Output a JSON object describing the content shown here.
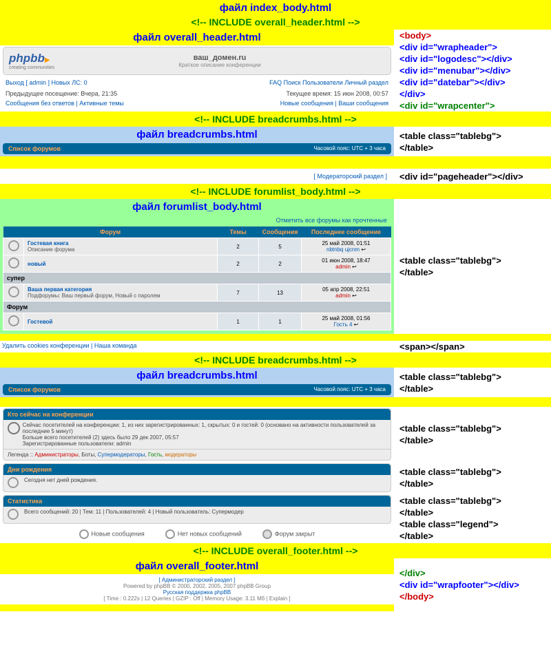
{
  "titles": {
    "index_body": "файл index_body.html",
    "inc_overall_header": "<!-- INCLUDE overall_header.html -->",
    "overall_header": "файл overall_header.html",
    "inc_breadcrumbs": "<!-- INCLUDE breadcrumbs.html -->",
    "breadcrumbs": "файл breadcrumbs.html",
    "inc_forumlist": "<!-- INCLUDE forumlist_body.html -->",
    "forumlist_body": "файл forumlist_body.html",
    "inc_overall_footer": "<!-- INCLUDE overall_footer.html -->",
    "overall_footer": "файл overall_footer.html"
  },
  "anno": {
    "body_open": "<body>",
    "wrapheader": "<div id=\"wrapheader\">",
    "logodesc": "<div id=\"logodesc\"></div>",
    "menubar": "<div id=\"menubar\"></div>",
    "datebar": "<div id=\"datebar\"></div>",
    "div_close": "</div>",
    "wrapcenter": "<div id=\"wrapcenter\">",
    "tablebg_open": "<table class=\"tablebg\">",
    "table_close": "</table>",
    "pageheader": "<div id=\"pageheader\"></div>",
    "span": "<span></span>",
    "legend_tbl": "<table class=\"legend\">",
    "wrapfooter": "<div id=\"wrapfooter\"></div>",
    "body_close": "</body>"
  },
  "header": {
    "logo": "phpbb",
    "logo_sub": "creating communities",
    "site": "ваш_домен.ru",
    "site_sub": "Краткое описание конференции",
    "menubar_left": "Выход [ admin ]   Новых ЛС: 0",
    "menubar_right": "FAQ   Поиск   Пользователи   Личный раздел",
    "datebar_left": "Предыдущее посещение: Вчера, 21:35",
    "datebar_right": "Текущее время: 15 июн 2008, 00:57",
    "msgs_left": "Сообщения без ответов | Активные темы",
    "msgs_right": "Новые сообщения | Ваши сообщения"
  },
  "breadcrumb": {
    "label": "Список форумов",
    "tz": "Часовой пояс: UTC + 3 часа"
  },
  "mod_link": "[ Модераторский раздел ]",
  "mark_link": "Отметить все форумы как прочтенные",
  "table_headers": {
    "forum": "Форум",
    "topics": "Темы",
    "posts": "Сообщения",
    "last": "Последнее сообщение"
  },
  "forums": [
    {
      "name": "Гостевая книга",
      "desc": "Описание форума",
      "topics": "2",
      "posts": "5",
      "last_date": "25 май 2008, 01:51",
      "last_user": "nbtnbq ujcnm",
      "user_class": "userblue"
    },
    {
      "name": "новый",
      "desc": "",
      "topics": "2",
      "posts": "2",
      "last_date": "01 июн 2008, 18:47",
      "last_user": "admin",
      "user_class": "user"
    }
  ],
  "cat1": "супер",
  "forum_cat1": {
    "name": "Ваша первая категория",
    "desc": "Подфорумы: Ваш первый форум, Новый с паролем",
    "topics": "7",
    "posts": "13",
    "last_date": "05 апр 2008, 22:51",
    "last_user": "admin"
  },
  "cat2": "Форум",
  "forum_cat2": {
    "name": "Гостевой",
    "desc": "",
    "topics": "1",
    "posts": "1",
    "last_date": "25 май 2008, 01:56",
    "last_user": "Гость 4"
  },
  "span_links": "Удалить cookies конференции | Наша команда",
  "whoisonline": {
    "hdr": "Кто сейчас на конференции",
    "line1": "Сейчас посетителей на конференции: 1, из них зарегистрированных: 1, скрытых: 0 и гостей: 0 (основано на активности пользователей за последние 5 минут)",
    "line2": "Больше всего посетителей (2) здесь было 29 дек 2007, 05:57",
    "line3": "Зарегистрированные пользователи: admin",
    "legend_label": "Легенда :: ",
    "legend": "Администраторы, Боты, Супермодераторы, Гость, модераторы"
  },
  "birthday": {
    "hdr": "Дни рождения",
    "body": "Сегодня нет дней рождения."
  },
  "stats": {
    "hdr": "Статистика",
    "body": "Всего сообщений: 20 | Тем: 11 | Пользователей: 4 | Новый пользователь: Супермодер"
  },
  "legend_icons": {
    "new": "Новые сообщения",
    "nonew": "Нет новых сообщений",
    "locked": "Форум закрыт"
  },
  "footer": {
    "admin": "[ Администраторский раздел ]",
    "powered": "Powered by phpBB © 2000, 2002, 2005, 2007 phpBB Group",
    "support": "Русская поддержка phpBB",
    "time": "[ Time : 0.222s | 12 Queries | GZIP : Off | Memory Usage: 3.11 Мб | Explain ]"
  }
}
